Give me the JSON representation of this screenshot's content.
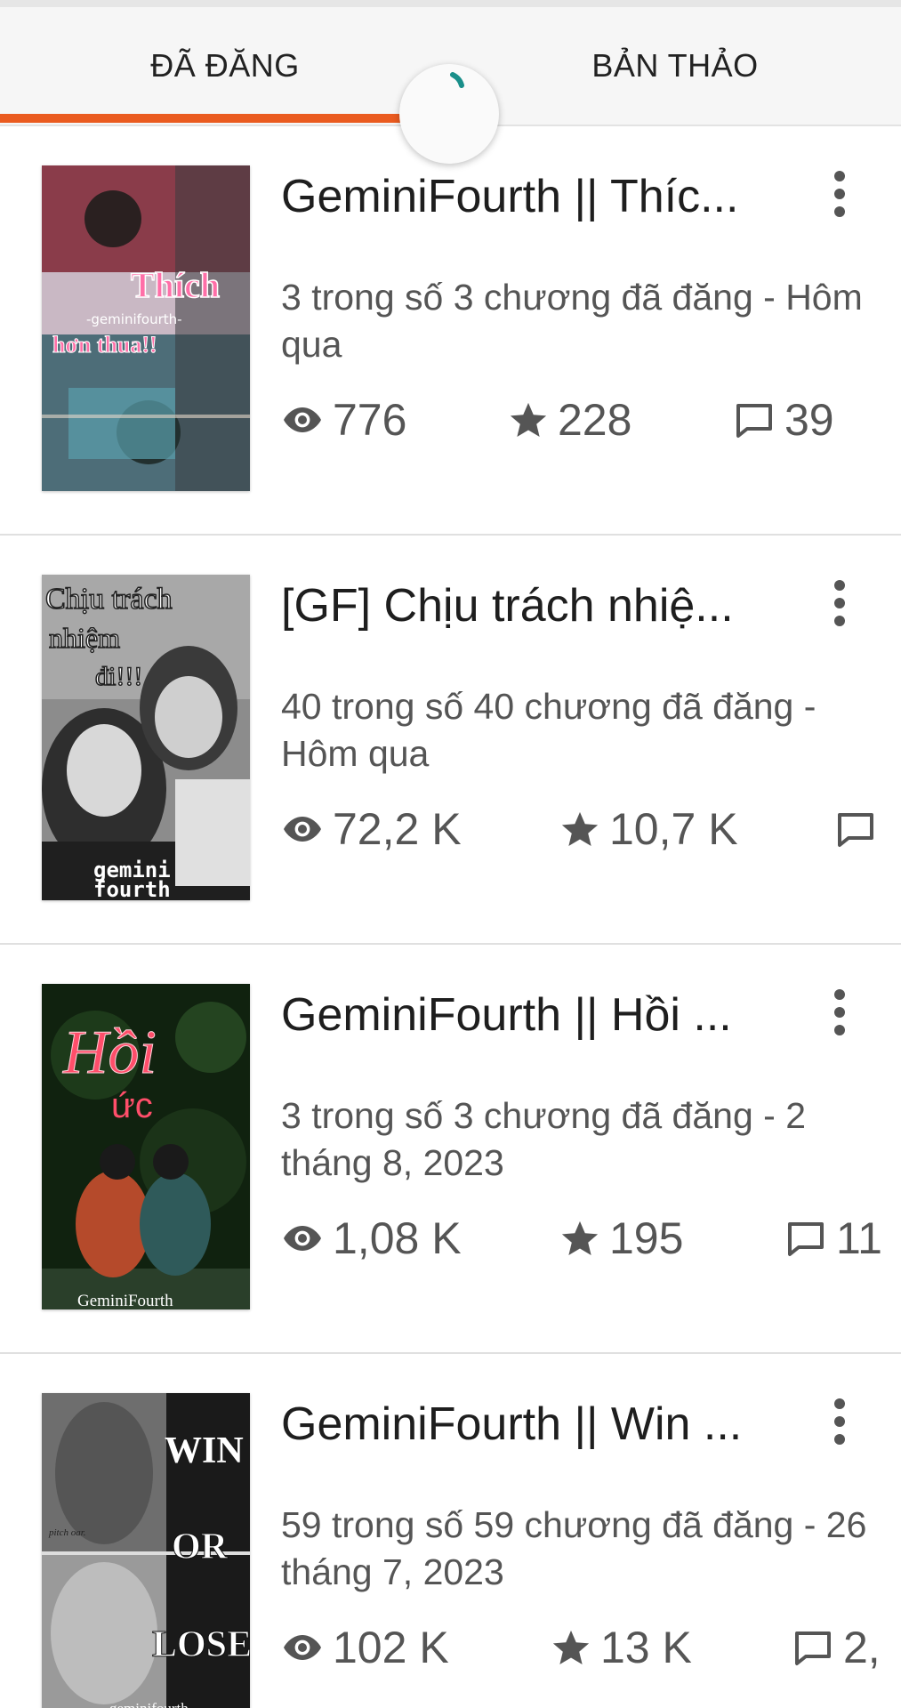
{
  "tabs": {
    "published_label": "ĐÃ ĐĂNG",
    "drafts_label": "BẢN THẢO"
  },
  "accent_color": "#ea5b20",
  "spinner_color": "#1a8f8a",
  "icons": {
    "views": "eye-icon",
    "votes": "star-icon",
    "comments": "comment-icon",
    "more": "more-vertical-icon"
  },
  "stories": [
    {
      "title": "GeminiFourth || Thíc...",
      "meta": "3 trong số 3 chương đã đăng - Hôm qua",
      "views": "776",
      "votes": "228",
      "comments": "39",
      "cover_text": [
        "Thích",
        "-geminifourth-",
        "hơn thua!!"
      ]
    },
    {
      "title": "[GF] Chịu trách nhiệ...",
      "meta": "40 trong số 40 chương đã đăng - Hôm qua",
      "views": "72,2 K",
      "votes": "10,7 K",
      "comments": "",
      "cover_text": [
        "Chịu trách",
        "nhiệm",
        "đi!!!",
        "gemini",
        "fourth"
      ]
    },
    {
      "title": "GeminiFourth || Hồi ...",
      "meta": "3 trong số 3 chương đã đăng - 2 tháng 8, 2023",
      "views": "1,08 K",
      "votes": "195",
      "comments": "11",
      "cover_text": [
        "Hồi",
        "ức",
        "GeminiFourth"
      ]
    },
    {
      "title": "GeminiFourth || Win ...",
      "meta": "59 trong số 59 chương đã đăng - 26 tháng 7, 2023",
      "views": "102 K",
      "votes": "13 K",
      "comments": "2,",
      "cover_text": [
        "WIN",
        "OR",
        "LOSE",
        "pitch oar.",
        "geminifourth"
      ]
    }
  ]
}
